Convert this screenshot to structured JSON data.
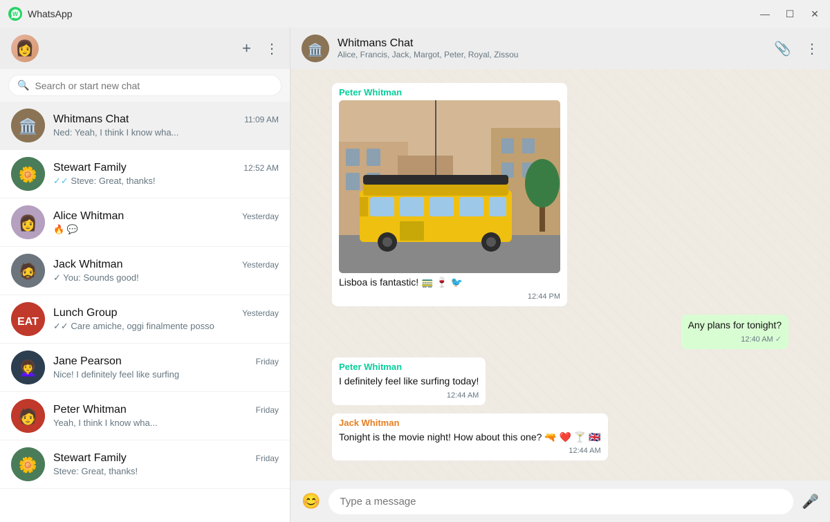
{
  "titlebar": {
    "app_name": "WhatsApp",
    "minimize": "—",
    "maximize": "☐",
    "close": "✕"
  },
  "sidebar": {
    "search_placeholder": "Search or start new chat",
    "new_chat_icon": "+",
    "menu_icon": "⋮",
    "chats": [
      {
        "id": "whitmans-chat",
        "name": "Whitmans Chat",
        "preview": "Ned: Yeah, I think I know wha...",
        "time": "11:09 AM",
        "avatar_emoji": "🏛️",
        "avatar_bg": "#8b7355",
        "tick": "none"
      },
      {
        "id": "stewart-family",
        "name": "Stewart Family",
        "preview": "Steve: Great, thanks!",
        "time": "12:52 AM",
        "avatar_emoji": "🌼",
        "avatar_bg": "#4a7c59",
        "tick": "double-blue"
      },
      {
        "id": "alice-whitman",
        "name": "Alice Whitman",
        "preview": "🔥 💬",
        "time": "Yesterday",
        "avatar_emoji": "👩",
        "avatar_bg": "#b5a0c0",
        "tick": "none"
      },
      {
        "id": "jack-whitman",
        "name": "Jack Whitman",
        "preview": "You: Sounds good!",
        "time": "Yesterday",
        "avatar_emoji": "🧔",
        "avatar_bg": "#8a9ab5",
        "tick": "single-gray"
      },
      {
        "id": "lunch-group",
        "name": "Lunch Group",
        "preview": "Care amiche, oggi finalmente posso",
        "time": "Yesterday",
        "avatar_emoji": "🍽️",
        "avatar_bg": "#c0392b",
        "tick": "double-gray"
      },
      {
        "id": "jane-pearson",
        "name": "Jane Pearson",
        "preview": "Nice! I definitely feel like surfing",
        "time": "Friday",
        "avatar_emoji": "👩‍🦱",
        "avatar_bg": "#2c3e50",
        "tick": "none"
      },
      {
        "id": "peter-whitman",
        "name": "Peter Whitman",
        "preview": "Yeah, I think I know wha...",
        "time": "Friday",
        "avatar_emoji": "🧑",
        "avatar_bg": "#c0392b",
        "tick": "none"
      },
      {
        "id": "stewart-family-2",
        "name": "Stewart Family",
        "preview": "Steve: Great, thanks!",
        "time": "Friday",
        "avatar_emoji": "🌼",
        "avatar_bg": "#4a7c59",
        "tick": "none"
      }
    ]
  },
  "chat": {
    "name": "Whitmans Chat",
    "members": "Alice, Francis, Jack, Margot, Peter, Royal, Zissou",
    "messages": [
      {
        "id": "msg1",
        "sender": "Peter Whitman",
        "sender_color": "#06cf9c",
        "type": "image+text",
        "text": "Lisboa is fantastic! 🚃 🍷 🐦",
        "time": "12:44 PM",
        "direction": "incoming"
      },
      {
        "id": "msg2",
        "sender": "",
        "type": "text",
        "text": "Any plans for tonight?",
        "time": "12:40 AM",
        "direction": "outgoing",
        "tick": "single"
      },
      {
        "id": "msg3",
        "sender": "Peter Whitman",
        "sender_color": "#06cf9c",
        "type": "text",
        "text": "I definitely feel like surfing today!",
        "time": "12:44 AM",
        "direction": "incoming"
      },
      {
        "id": "msg4",
        "sender": "Jack Whitman",
        "sender_color": "#e67e22",
        "type": "text",
        "text": "Tonight is the movie night! How about this one? 🔫 ❤️ 🍸 🇬🇧",
        "time": "12:44 AM",
        "direction": "incoming"
      }
    ],
    "input_placeholder": "Type a message"
  }
}
